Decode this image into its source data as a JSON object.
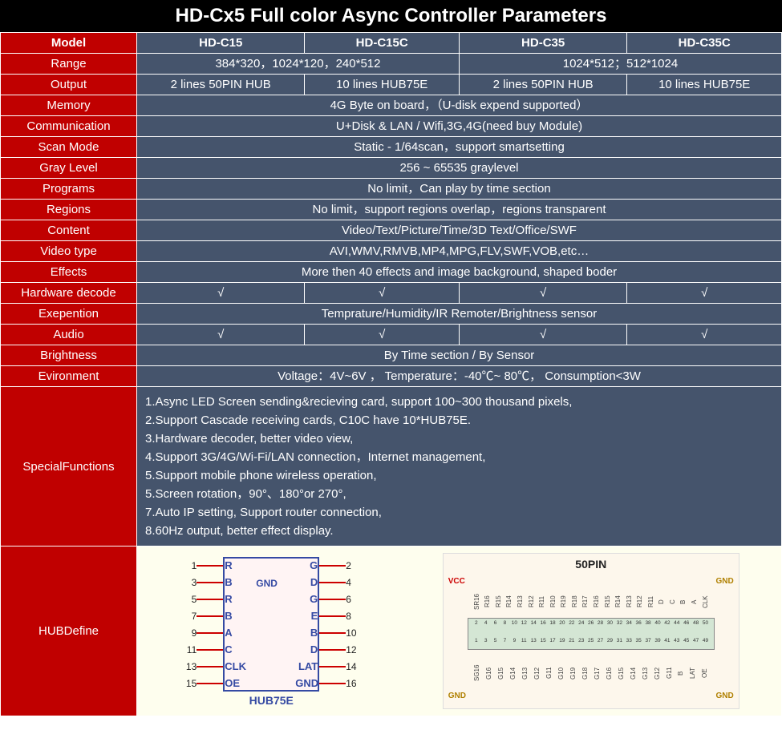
{
  "title": "HD-Cx5 Full color Async Controller Parameters",
  "headers": {
    "model": "Model",
    "c1": "HD-C15",
    "c2": "HD-C15C",
    "c3": "HD-C35",
    "c4": "HD-C35C"
  },
  "rows": {
    "range": {
      "label": "Range",
      "v1": "384*320，1024*120，240*512",
      "v2": "1024*512；512*1024"
    },
    "output": {
      "label": "Output",
      "v1": "2 lines 50PIN HUB",
      "v2": "10 lines HUB75E",
      "v3": "2 lines 50PIN HUB",
      "v4": "10 lines HUB75E"
    },
    "memory": {
      "label": "Memory",
      "v": "4G Byte on board，（U-disk expend supported）"
    },
    "comm": {
      "label": "Communication",
      "v": "U+Disk & LAN / Wifi,3G,4G(need buy Module)"
    },
    "scan": {
      "label": "Scan Mode",
      "v": "Static - 1/64scan，support smartsetting"
    },
    "gray": {
      "label": "Gray Level",
      "v": "256 ~ 65535 graylevel"
    },
    "programs": {
      "label": "Programs",
      "v": "No limit，Can play by time section"
    },
    "regions": {
      "label": "Regions",
      "v": "No limit，support regions overlap，regions transparent"
    },
    "content": {
      "label": "Content",
      "v": "Video/Text/Picture/Time/3D Text/Office/SWF"
    },
    "videotype": {
      "label": "Video type",
      "v": "AVI,WMV,RMVB,MP4,MPG,FLV,SWF,VOB,etc…"
    },
    "effects": {
      "label": "Effects",
      "v": "More then 40 effects and image background, shaped boder"
    },
    "hwdecode": {
      "label": "Hardware decode",
      "v1": "√",
      "v2": "√",
      "v3": "√",
      "v4": "√"
    },
    "exp": {
      "label": "Exepention",
      "v": "Temprature/Humidity/IR Remoter/Brightness sensor"
    },
    "audio": {
      "label": "Audio",
      "v1": "√",
      "v2": "√",
      "v3": "√",
      "v4": "√"
    },
    "brightness": {
      "label": "Brightness",
      "v": "By Time section / By Sensor"
    },
    "env": {
      "label": "Evironment",
      "v": "Voltage：4V~6V ， Temperature：-40℃~ 80℃， Consumption<3W"
    },
    "special": {
      "label": "SpecialFunctions",
      "l1": "1.Async LED Screen sending&recieving card, support 100~300 thousand pixels,",
      "l2": "2.Support Cascade receiving cards, C10C have 10*HUB75E.",
      "l3": "3.Hardware decoder, better video view,",
      "l4": "4.Support 3G/4G/Wi-Fi/LAN connection，Internet management,",
      "l5": "5.Support mobile phone wireless operation,",
      "l6": "5.Screen rotation，90°、180°or 270°,",
      "l7": "7.Auto IP setting, Support router connection,",
      "l8": "8.60Hz output, better effect display."
    },
    "hubdef": {
      "label": "HUBDefine"
    }
  },
  "hub75": {
    "caption": "HUB75E",
    "gnd": "GND",
    "left": [
      {
        "n": "1",
        "t": "R"
      },
      {
        "n": "3",
        "t": "B"
      },
      {
        "n": "5",
        "t": "R"
      },
      {
        "n": "7",
        "t": "B"
      },
      {
        "n": "9",
        "t": "A"
      },
      {
        "n": "11",
        "t": "C"
      },
      {
        "n": "13",
        "t": "CLK"
      },
      {
        "n": "15",
        "t": "OE"
      }
    ],
    "right": [
      {
        "n": "2",
        "t": "G"
      },
      {
        "n": "4",
        "t": "D"
      },
      {
        "n": "6",
        "t": "G"
      },
      {
        "n": "8",
        "t": "E"
      },
      {
        "n": "10",
        "t": "B"
      },
      {
        "n": "12",
        "t": "D"
      },
      {
        "n": "14",
        "t": "LAT"
      },
      {
        "n": "16",
        "t": "GND"
      }
    ]
  },
  "pin50": {
    "caption": "50PIN",
    "vcc": "VCC",
    "gnd": "GND",
    "top_labels": [
      "SR16",
      "R16",
      "R15",
      "R14",
      "R13",
      "R12",
      "R11",
      "R10",
      "R19",
      "R18",
      "R17",
      "R16",
      "R15",
      "R14",
      "R13",
      "R12",
      "R11",
      "D",
      "C",
      "B",
      "A",
      "CLK"
    ],
    "bot_labels": [
      "SG16",
      "G16",
      "G15",
      "G14",
      "G13",
      "G12",
      "G11",
      "G10",
      "G19",
      "G18",
      "G17",
      "G16",
      "G15",
      "G14",
      "G13",
      "G12",
      "G11",
      "B",
      "LAT",
      "OE"
    ],
    "nums_top": [
      "2",
      "4",
      "6",
      "8",
      "10",
      "12",
      "14",
      "16",
      "18",
      "20",
      "22",
      "24",
      "26",
      "28",
      "30",
      "32",
      "34",
      "36",
      "38",
      "40",
      "42",
      "44",
      "46",
      "48",
      "50"
    ],
    "nums_bot": [
      "1",
      "3",
      "5",
      "7",
      "9",
      "11",
      "13",
      "15",
      "17",
      "19",
      "21",
      "23",
      "25",
      "27",
      "29",
      "31",
      "33",
      "35",
      "37",
      "39",
      "41",
      "43",
      "45",
      "47",
      "49"
    ]
  }
}
